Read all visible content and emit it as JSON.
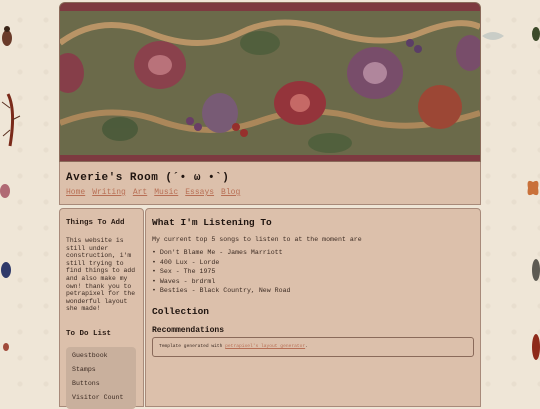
{
  "site": {
    "title": "Averie's Room (´• ω •`)",
    "nav": [
      "Home",
      "Writing",
      "Art",
      "Music",
      "Essays",
      "Blog"
    ]
  },
  "sidebar": {
    "things_heading": "Things To Add",
    "things_text": "This website is still under construction, i'm still trying to find things to add and also make my own! thank you to petrapixel for the wonderful layout she made!",
    "todo_heading": "To Do List",
    "todo_items": [
      "Guestbook",
      "Stamps",
      "Buttons",
      "Visitor Count"
    ]
  },
  "main": {
    "heading": "What I'm Listening To",
    "intro": "My current top 5 songs to listen to at the moment are",
    "songs": [
      "Don't Blame Me - James Marriott",
      "400 Lux - Lorde",
      "Sex - The 1975",
      "Waves - brdrml",
      "Besties - Black Country, New Road"
    ],
    "collection_heading": "Collection",
    "recommendations_heading": "Recommendations",
    "template_prefix": "Template generated with",
    "template_link": "petrapixel's layout generator",
    "template_suffix": "."
  },
  "colors": {
    "page_bg": "#efe6d7",
    "panel_bg": "#dcc0ab",
    "link": "#b86f55",
    "banner_border": "#7d3a40"
  }
}
